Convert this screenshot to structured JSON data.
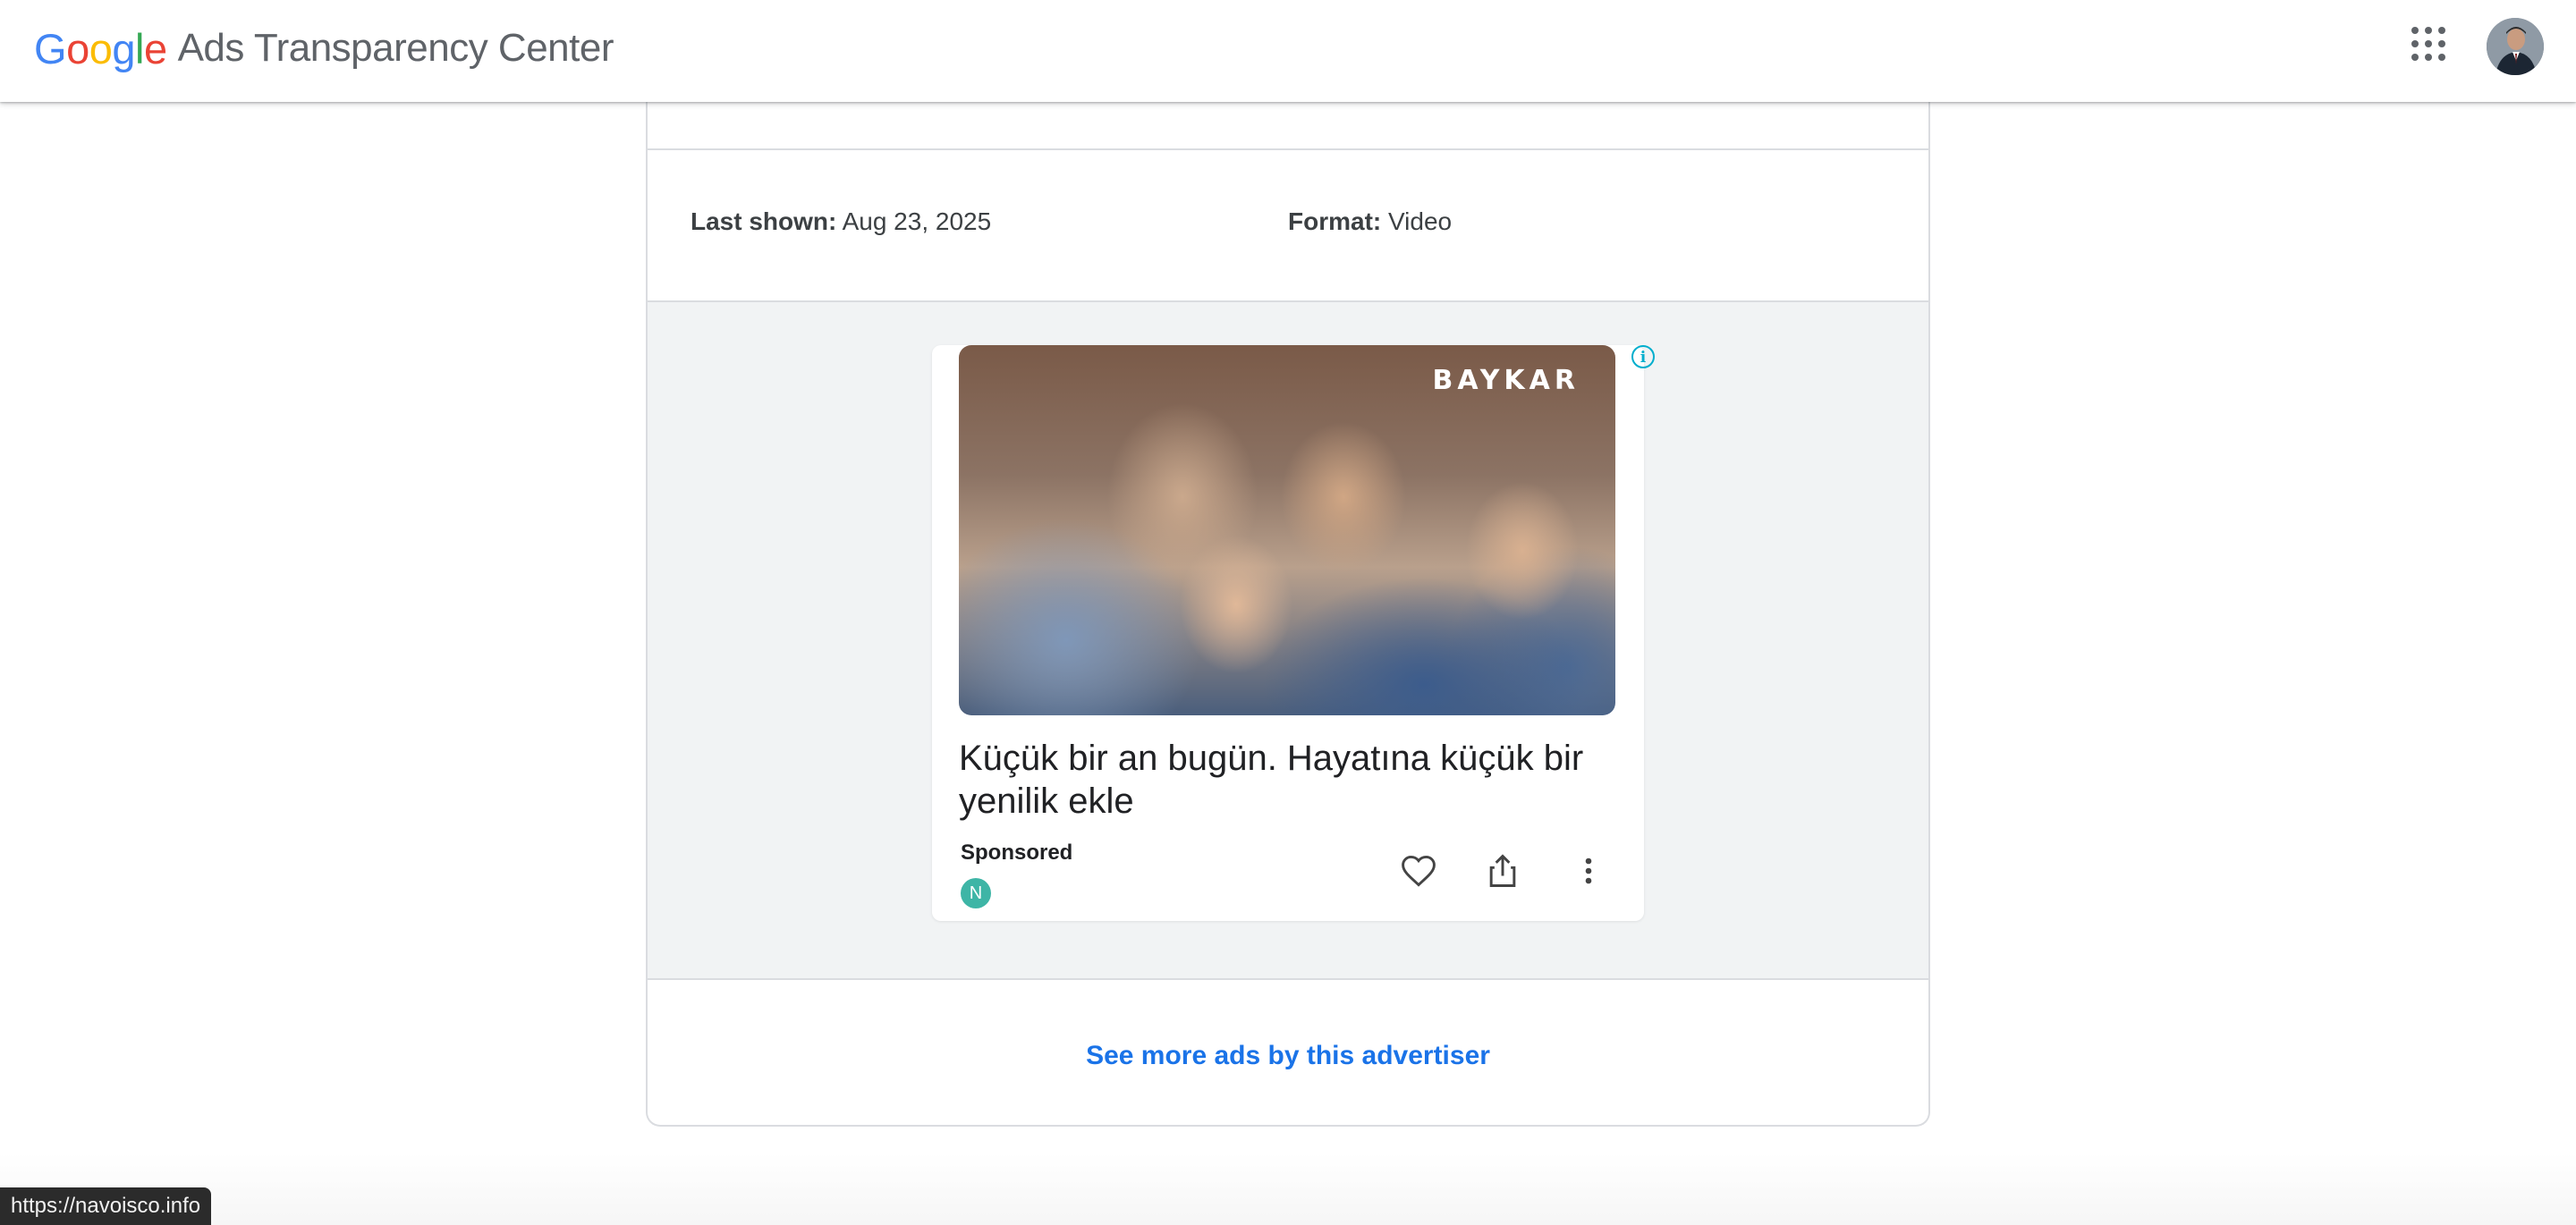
{
  "header": {
    "logo_google": [
      "G",
      "o",
      "o",
      "g",
      "l",
      "e"
    ],
    "logo_colors": [
      "#4285F4",
      "#EA4335",
      "#FBBC05",
      "#4285F4",
      "#34A853",
      "#EA4335"
    ],
    "product_name": "Ads Transparency Center",
    "apps_icon": "apps-grid-icon",
    "avatar_icon": "account-avatar"
  },
  "details": {
    "last_shown_label": "Last shown:",
    "last_shown_value": "Aug 23, 2025",
    "format_label": "Format:",
    "format_value": "Video"
  },
  "ad_preview": {
    "brand_overlay": "BAYKAR",
    "info_icon": "info-icon",
    "headline": "Küçük bir an bugün. Hayatına küçük bir yenilik ekle",
    "sponsored_label": "Sponsored",
    "advertiser_initial": "N",
    "actions": [
      "heart-icon",
      "share-icon",
      "more-vert-icon"
    ]
  },
  "footer_link": {
    "label": "See more ads by this advertiser"
  },
  "status_bar": {
    "url": "https://navoisco.info"
  },
  "colors": {
    "link": "#1a73e8",
    "info_accent": "#00aecd",
    "advertiser_badge": "#3eb5a6",
    "preview_background": "#f1f3f4"
  }
}
